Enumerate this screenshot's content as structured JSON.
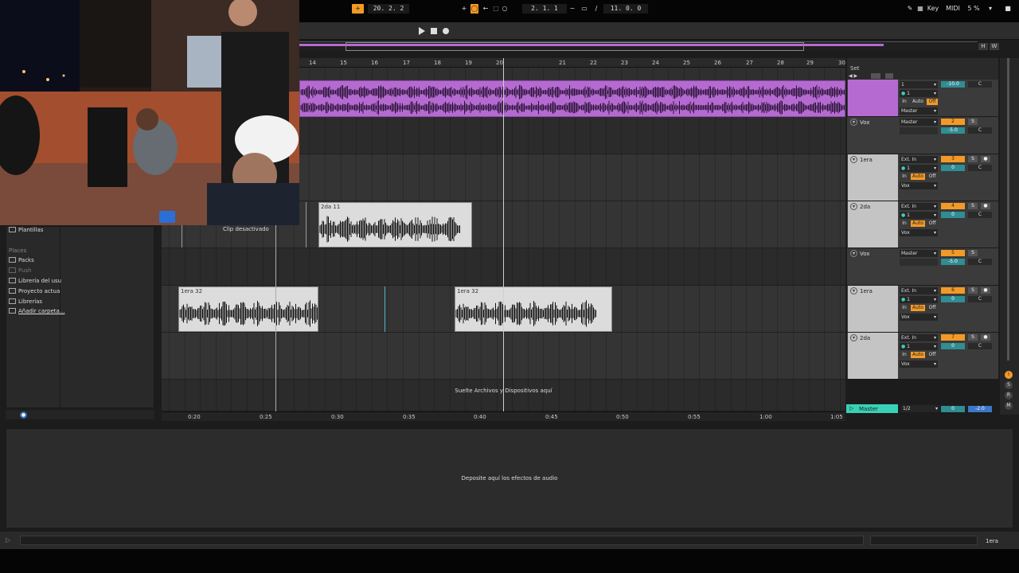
{
  "transport": {
    "tempo": "20. 2. 2",
    "position": "2. 1. 1",
    "loop_length": "11. 0. 0",
    "key_label": "Key",
    "midi_label": "MIDI",
    "cpu": "5 %",
    "h_label": "H",
    "w_label": "W"
  },
  "ruler": {
    "bars": [
      "14",
      "15",
      "16",
      "17",
      "18",
      "19",
      "20",
      "21",
      "22",
      "23",
      "24",
      "25",
      "26",
      "27",
      "28",
      "29",
      "30"
    ]
  },
  "time_ruler": [
    "0:20",
    "0:25",
    "0:30",
    "0:35",
    "0:40",
    "0:45",
    "0:50",
    "0:55",
    "1:00",
    "1:05"
  ],
  "clips": {
    "clip_2da": "2da 11",
    "clip_1era_a": "1era 32",
    "clip_1era_b": "1era 32",
    "deactivated": "Clip desactivado"
  },
  "arrangement": {
    "drop_files": "Suelte Archivos y Dispositivos aquí",
    "set_label": "Set"
  },
  "tracks": [
    {
      "name": "",
      "input": "1",
      "mon_in": "In",
      "mon_auto": "Auto",
      "mon_off": "Off",
      "output": "Master",
      "number": "",
      "volume": "-10.0",
      "pan": "C"
    },
    {
      "name": "Vox",
      "output": "Master",
      "number": "2",
      "solo": "S",
      "volume": "-5.0",
      "pan": "C"
    },
    {
      "name": "1era",
      "input": "Ext. In",
      "channel": "1",
      "mon_in": "In",
      "mon_auto": "Auto",
      "mon_off": "Off",
      "output": "Vox",
      "number": "3",
      "solo": "S",
      "volume": "0",
      "pan": "C"
    },
    {
      "name": "2da",
      "input": "Ext. In",
      "channel": "1",
      "mon_in": "In",
      "mon_auto": "Auto",
      "mon_off": "Off",
      "output": "Vox",
      "number": "4",
      "solo": "S",
      "volume": "0",
      "pan": "C"
    },
    {
      "name": "Vox",
      "output": "Master",
      "number": "5",
      "solo": "S",
      "volume": "-5.0",
      "pan": "C"
    },
    {
      "name": "1era",
      "input": "Ext. In",
      "channel": "1",
      "mon_in": "In",
      "mon_auto": "Auto",
      "mon_off": "Off",
      "output": "Vox",
      "number": "6",
      "solo": "S",
      "volume": "0",
      "pan": "C"
    },
    {
      "name": "2da",
      "input": "Ext. In",
      "channel": "1",
      "mon_in": "In",
      "mon_auto": "Auto",
      "mon_off": "Off",
      "output": "Vox",
      "number": "7",
      "solo": "S",
      "volume": "0",
      "pan": "C"
    }
  ],
  "master": {
    "name": "Master",
    "output": "1/2",
    "volume": "0",
    "pan": "-2.0"
  },
  "browser": {
    "templates": "Plantillas",
    "places_header": "Places",
    "packs": "Packs",
    "push": "Push",
    "user_library": "Librería del usu",
    "current_project": "Proyecto actua",
    "libraries": "Librerías",
    "add_folder": "Añadir carpeta..."
  },
  "devices": {
    "drop_effects": "Deposite aquí los efectos de audio"
  },
  "status": {
    "selected_track": "1era"
  },
  "colors": {
    "accent_orange": "#f39a26",
    "clip_purple": "#b56ad2",
    "master_teal": "#39d1b6",
    "volume_teal": "#2f8d93"
  }
}
